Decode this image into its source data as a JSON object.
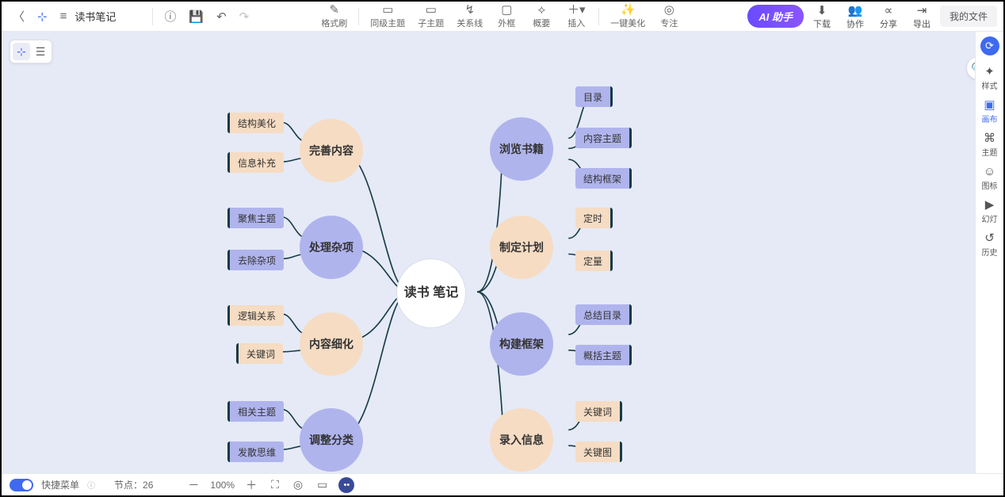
{
  "header": {
    "title": "读书笔记",
    "toolbar": {
      "format": "格式刷",
      "sibling": "同级主题",
      "child": "子主题",
      "relation": "关系线",
      "outline": "外框",
      "summary": "概要",
      "insert": "插入",
      "beautify": "一键美化",
      "focus": "专注"
    },
    "ai": "AI 助手",
    "actions": {
      "download": "下载",
      "collab": "协作",
      "share": "分享",
      "export": "导出"
    },
    "myfiles": "我的文件"
  },
  "rside": {
    "style": "样式",
    "canvas": "画布",
    "theme": "主题",
    "icon": "图标",
    "slide": "幻灯",
    "history": "历史"
  },
  "bottom": {
    "quickmenu": "快捷菜单",
    "nodecount_label": "节点：",
    "nodecount": "26",
    "zoom": "100%"
  },
  "mindmap": {
    "center": "读书\n笔记",
    "left": [
      {
        "label": "完善内容",
        "color": "orange",
        "children": [
          "结构美化",
          "信息补充"
        ]
      },
      {
        "label": "处理杂项",
        "color": "purple",
        "children": [
          "聚焦主题",
          "去除杂项"
        ]
      },
      {
        "label": "内容细化",
        "color": "orange",
        "children": [
          "逻辑关系",
          "关键词"
        ]
      },
      {
        "label": "调整分类",
        "color": "purple",
        "children": [
          "相关主题",
          "发散思维"
        ]
      }
    ],
    "right": [
      {
        "label": "浏览书籍",
        "color": "purple",
        "children": [
          "目录",
          "内容主题",
          "结构框架"
        ]
      },
      {
        "label": "制定计划",
        "color": "orange",
        "children": [
          "定时",
          "定量"
        ]
      },
      {
        "label": "构建框架",
        "color": "purple",
        "children": [
          "总结目录",
          "概括主题"
        ]
      },
      {
        "label": "录入信息",
        "color": "orange",
        "children": [
          "关键词",
          "关键图"
        ]
      }
    ]
  }
}
